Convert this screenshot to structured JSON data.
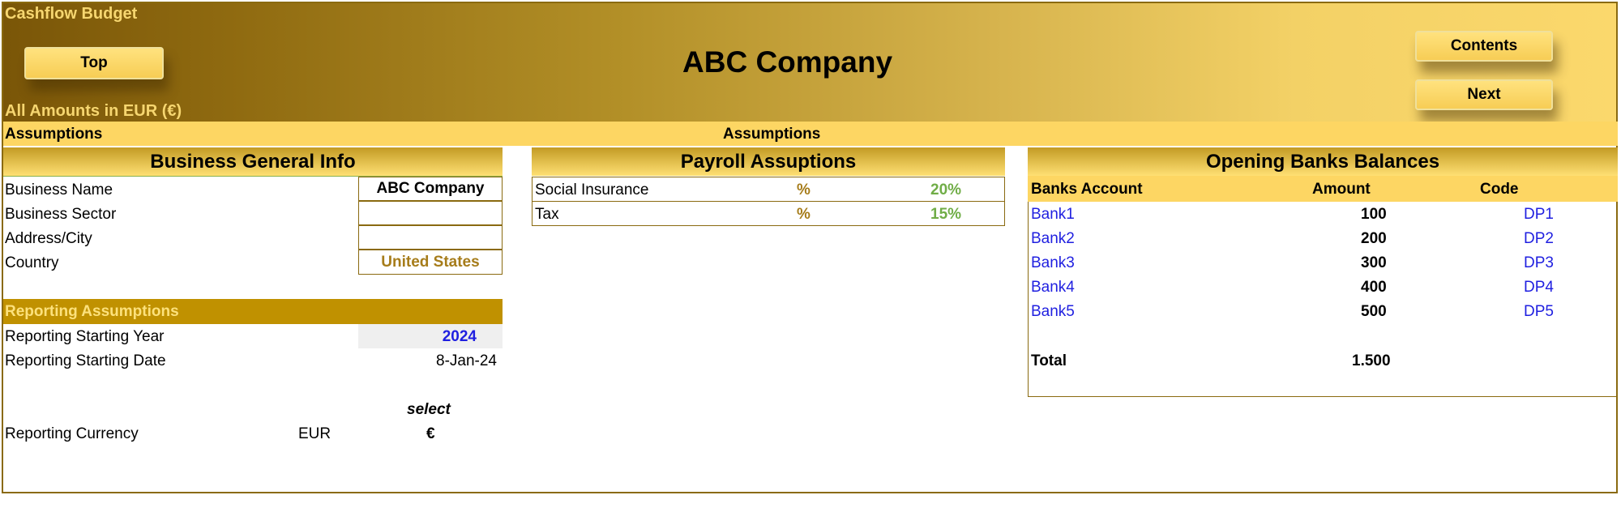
{
  "header": {
    "sheet_title": "Cashflow Budget",
    "company": "ABC Company",
    "amounts_label": "All Amounts in  EUR (€)",
    "top_button": "Top",
    "contents_button": "Contents",
    "next_button": "Next"
  },
  "bar": {
    "left": "Assumptions",
    "center": "Assumptions"
  },
  "business_info": {
    "title": "Business General Info",
    "rows": [
      {
        "label": "Business Name",
        "value": "ABC Company"
      },
      {
        "label": "Business Sector",
        "value": ""
      },
      {
        "label": "Address/City",
        "value": ""
      },
      {
        "label": "Country",
        "value": "United States"
      }
    ]
  },
  "reporting": {
    "title": "Reporting Assumptions",
    "start_year_label": "Reporting Starting Year",
    "start_year": "2024",
    "start_date_label": "Reporting Starting Date",
    "start_date": "8-Jan-24",
    "select_label": "select",
    "currency_label": "Reporting Currency",
    "currency_code": "EUR",
    "currency_symbol": "€"
  },
  "payroll": {
    "title": "Payroll Assuptions",
    "rows": [
      {
        "label": "Social Insurance",
        "unit": "%",
        "value": "20%"
      },
      {
        "label": "Tax",
        "unit": "%",
        "value": "15%"
      }
    ]
  },
  "banks": {
    "title": "Opening Banks Balances",
    "col_account": "Banks Account",
    "col_amount": "Amount",
    "col_code": "Code",
    "rows": [
      {
        "account": "Bank1",
        "amount": "100",
        "code": "DP1"
      },
      {
        "account": "Bank2",
        "amount": "200",
        "code": "DP2"
      },
      {
        "account": "Bank3",
        "amount": "300",
        "code": "DP3"
      },
      {
        "account": "Bank4",
        "amount": "400",
        "code": "DP4"
      },
      {
        "account": "Bank5",
        "amount": "500",
        "code": "DP5"
      }
    ],
    "total_label": "Total",
    "total_value": "1.500"
  },
  "colors": {
    "gold_dark": "#7a5608",
    "gold_bar": "#fdd663",
    "gold_section": "#c09100",
    "link_blue": "#1f1fe0",
    "green": "#70ad47"
  }
}
